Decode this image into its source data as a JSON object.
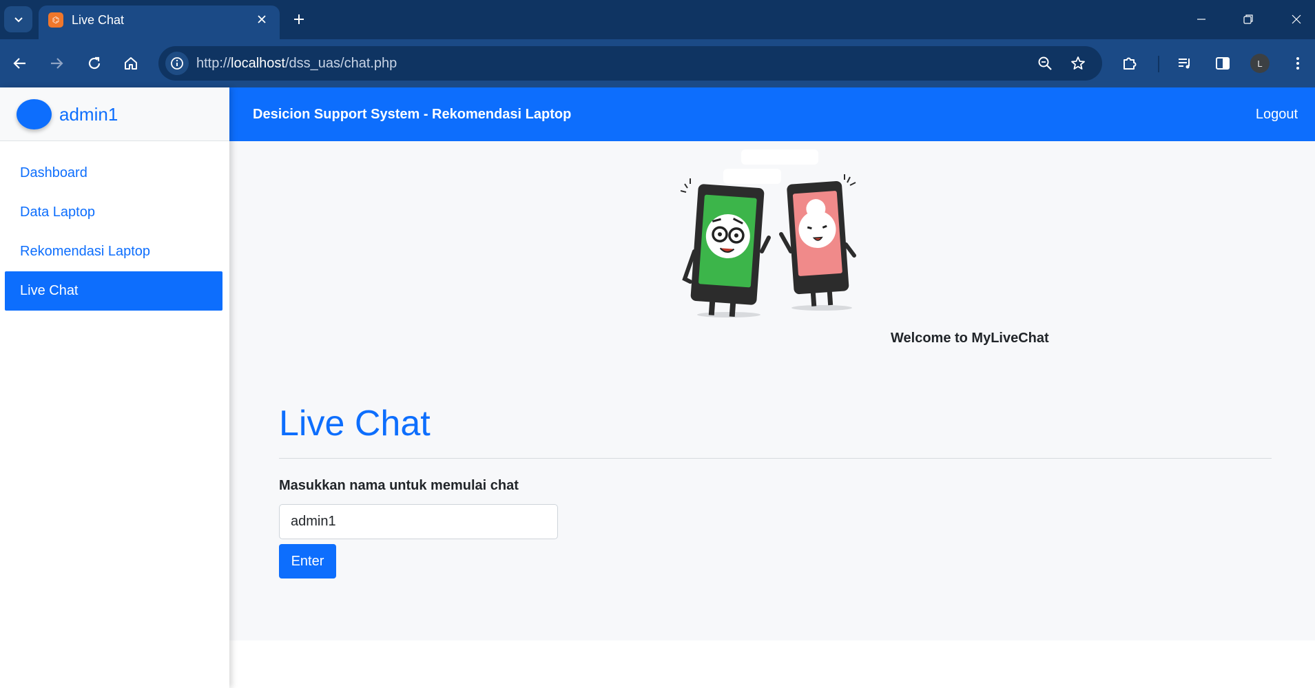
{
  "browser": {
    "tab_title": "Live Chat",
    "url_scheme": "http://",
    "url_host": "localhost",
    "url_path": "/dss_uas/chat.php",
    "profile_initial": "L",
    "favicon_glyph": "⌬",
    "favicon_color": "#f0772b"
  },
  "sidebar": {
    "username": "admin1",
    "items": [
      {
        "label": "Dashboard",
        "active": false
      },
      {
        "label": "Data Laptop",
        "active": false
      },
      {
        "label": "Rekomendasi Laptop",
        "active": false
      },
      {
        "label": "Live Chat",
        "active": true
      }
    ]
  },
  "topnav": {
    "brand": "Desicion Support System - Rekomendasi Laptop",
    "logout_label": "Logout"
  },
  "main": {
    "welcome": "Welcome to MyLiveChat",
    "title": "Live Chat",
    "form_label": "Masukkan nama untuk memulai chat",
    "name_value": "admin1",
    "enter_label": "Enter"
  },
  "colors": {
    "primary": "#0d6efd",
    "browser_frame": "#0f3462",
    "browser_toolbar": "#1b4a86",
    "content_bg": "#f7f8fa"
  }
}
